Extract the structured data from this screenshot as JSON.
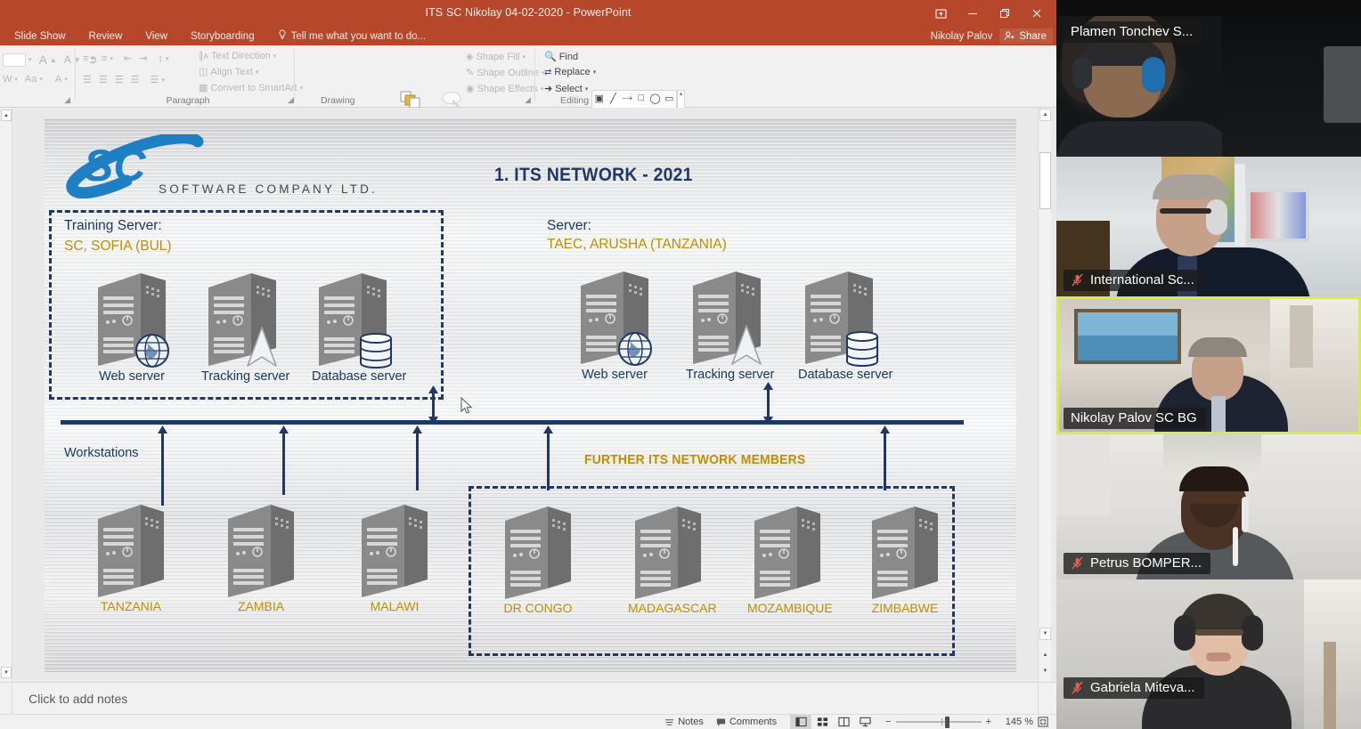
{
  "window": {
    "title": "ITS SC Nikolay 04-02-2020 - PowerPoint",
    "account_name": "Nikolay Palov",
    "share_label": "Share",
    "ribbon_display_icon": "ribbon-display-options-icon",
    "minimize_icon": "minimize-icon",
    "restore_icon": "restore-icon",
    "close_icon": "close-icon"
  },
  "menu": {
    "items": [
      {
        "label": "Slide Show"
      },
      {
        "label": "Review"
      },
      {
        "label": "View"
      },
      {
        "label": "Storyboarding"
      }
    ],
    "tell_me": "Tell me what you want to do..."
  },
  "ribbon": {
    "font_group": {
      "label": "",
      "grow_font": "A",
      "shrink_font": "A",
      "clear_format": "clear-formatting-icon",
      "char_spacing": "Aa",
      "text_effects": "A"
    },
    "paragraph_group": {
      "label": "Paragraph",
      "text_direction": "Text Direction",
      "align_text": "Align Text",
      "convert_smartart": "Convert to SmartArt"
    },
    "drawing_group": {
      "label": "Drawing",
      "arrange": "Arrange",
      "quick_styles_line1": "Quick",
      "quick_styles_line2": "Styles",
      "shape_fill": "Shape Fill",
      "shape_outline": "Shape Outline",
      "shape_effects": "Shape Effects"
    },
    "editing_group": {
      "label": "Editing",
      "find": "Find",
      "replace": "Replace",
      "select": "Select"
    }
  },
  "slide": {
    "logo": {
      "mark": "SC",
      "tagline": "SOFTWARE COMPANY LTD."
    },
    "title": "1. ITS NETWORK - 2021",
    "left_zone": {
      "header": "Training Server:",
      "location": "SC, SOFIA (BUL)",
      "servers": [
        {
          "name": "Web server",
          "badge": "globe-icon"
        },
        {
          "name": "Tracking server",
          "badge": "cursor-arrow-icon"
        },
        {
          "name": "Database server",
          "badge": "database-cylinder-icon"
        }
      ]
    },
    "right_zone": {
      "header": "Server:",
      "location": "TAEC, ARUSHA (TANZANIA)",
      "servers": [
        {
          "name": "Web server",
          "badge": "globe-icon"
        },
        {
          "name": "Tracking server",
          "badge": "cursor-arrow-icon"
        },
        {
          "name": "Database server",
          "badge": "database-cylinder-icon"
        }
      ]
    },
    "workstations_label": "Workstations",
    "further_members_label": "FURTHER ITS NETWORK MEMBERS",
    "workstations": [
      {
        "name": "TANZANIA"
      },
      {
        "name": "ZAMBIA"
      },
      {
        "name": "MALAWI"
      }
    ],
    "further_members": [
      {
        "name": "DR CONGO"
      },
      {
        "name": "MADAGASCAR"
      },
      {
        "name": "MOZAMBIQUE"
      },
      {
        "name": "ZIMBABWE"
      }
    ],
    "colors": {
      "navy": "#1f3864",
      "heading_blue": "#17375e",
      "gold": "#bf8f00",
      "logo_blue": "#1f7fc4"
    }
  },
  "notes": {
    "placeholder": "Click to add notes"
  },
  "status_bar": {
    "notes_label": "Notes",
    "comments_label": "Comments",
    "views": [
      {
        "name": "normal-view-button",
        "active": true
      },
      {
        "name": "slide-sorter-view-button",
        "active": false
      },
      {
        "name": "reading-view-button",
        "active": false
      },
      {
        "name": "slide-show-view-button",
        "active": false
      }
    ],
    "zoom_out": "−",
    "zoom_in": "+",
    "zoom_level": "145 %",
    "fit_slide": "fit-slide-to-window-icon"
  },
  "video_panel": {
    "participants": [
      {
        "name": "Plamen Tonchev S...",
        "muted": false,
        "active_speaker": false,
        "name_position": "top"
      },
      {
        "name": "International Sc...",
        "muted": true,
        "active_speaker": false,
        "name_position": "bottom"
      },
      {
        "name": "Nikolay Palov SC BG",
        "muted": false,
        "active_speaker": true,
        "name_position": "bottom"
      },
      {
        "name": "Petrus BOMPER...",
        "muted": true,
        "active_speaker": false,
        "name_position": "bottom"
      },
      {
        "name": "Gabriela Miteva...",
        "muted": true,
        "active_speaker": false,
        "name_position": "bottom"
      }
    ],
    "active_speaker_color": "#d6ec4a",
    "mute_icon_color": "#e8604c"
  }
}
